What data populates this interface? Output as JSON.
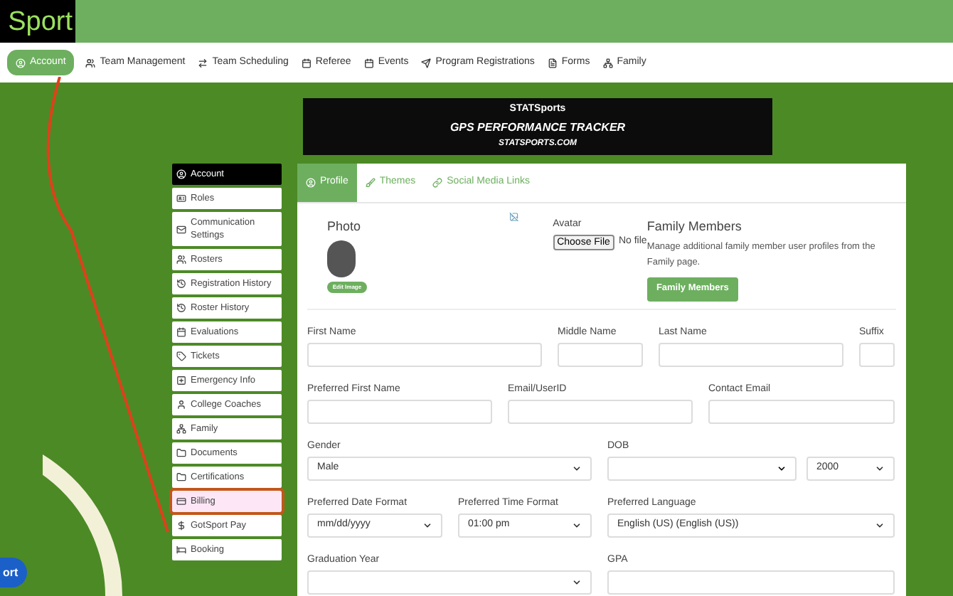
{
  "header": {
    "logo": "Sport"
  },
  "nav": [
    {
      "label": "Account",
      "selected": true
    },
    {
      "label": "Team Management",
      "selected": false
    },
    {
      "label": "Team Scheduling",
      "selected": false
    },
    {
      "label": "Referee",
      "selected": false
    },
    {
      "label": "Events",
      "selected": false
    },
    {
      "label": "Program Registrations",
      "selected": false
    },
    {
      "label": "Forms",
      "selected": false
    },
    {
      "label": "Family",
      "selected": false
    }
  ],
  "ad": {
    "brand": "STATSports",
    "headline": "GPS PERFORMANCE TRACKER",
    "url": "STATSPORTS.COM"
  },
  "sidebar": [
    {
      "label": "Account",
      "selected": true,
      "highlighted": false
    },
    {
      "label": "Roles",
      "selected": false,
      "highlighted": false
    },
    {
      "label": "Communication Settings",
      "selected": false,
      "highlighted": false
    },
    {
      "label": "Rosters",
      "selected": false,
      "highlighted": false
    },
    {
      "label": "Registration History",
      "selected": false,
      "highlighted": false
    },
    {
      "label": "Roster History",
      "selected": false,
      "highlighted": false
    },
    {
      "label": "Evaluations",
      "selected": false,
      "highlighted": false
    },
    {
      "label": "Tickets",
      "selected": false,
      "highlighted": false
    },
    {
      "label": "Emergency Info",
      "selected": false,
      "highlighted": false
    },
    {
      "label": "College Coaches",
      "selected": false,
      "highlighted": false
    },
    {
      "label": "Family",
      "selected": false,
      "highlighted": false
    },
    {
      "label": "Documents",
      "selected": false,
      "highlighted": false
    },
    {
      "label": "Certifications",
      "selected": false,
      "highlighted": false
    },
    {
      "label": "Billing",
      "selected": false,
      "highlighted": true
    },
    {
      "label": "GotSport Pay",
      "selected": false,
      "highlighted": false
    },
    {
      "label": "Booking",
      "selected": false,
      "highlighted": false
    }
  ],
  "tabs": [
    {
      "label": "Profile",
      "selected": true
    },
    {
      "label": "Themes",
      "selected": false
    },
    {
      "label": "Social Media Links",
      "selected": false
    }
  ],
  "photo": {
    "title": "Photo",
    "button": "Edit Image"
  },
  "avatar": {
    "label": "Avatar",
    "button": "Choose File",
    "status": "No file"
  },
  "family": {
    "title": "Family Members",
    "text": "Manage additional family member user profiles from the Family page.",
    "button": "Family Members"
  },
  "form_rows": [
    [
      {
        "label": "First Name",
        "kind": "input"
      },
      {
        "label": "Middle Name",
        "kind": "input"
      },
      {
        "label": "Last Name",
        "kind": "input"
      },
      {
        "label": "Suffix",
        "kind": "input"
      }
    ],
    [
      {
        "label": "Preferred First Name",
        "kind": "input"
      },
      {
        "label": "Email/UserID",
        "kind": "input"
      },
      {
        "label": "Contact Email",
        "kind": "input"
      }
    ],
    [
      {
        "label": "Gender",
        "kind": "select",
        "value": "Male"
      },
      {
        "label": "DOB",
        "kind": "date",
        "year": "2000"
      }
    ],
    [
      {
        "label": "Preferred Date Format",
        "kind": "select",
        "value": "mm/dd/yyyy"
      },
      {
        "label": "Preferred Time Format",
        "kind": "select",
        "value": "01:00 pm"
      },
      {
        "label": "Preferred Language",
        "kind": "select",
        "value": "English (US) (English (US))"
      }
    ],
    [
      {
        "label": "Graduation Year",
        "kind": "select"
      },
      {
        "label": "GPA",
        "kind": "input"
      }
    ]
  ],
  "support_button": "ort"
}
